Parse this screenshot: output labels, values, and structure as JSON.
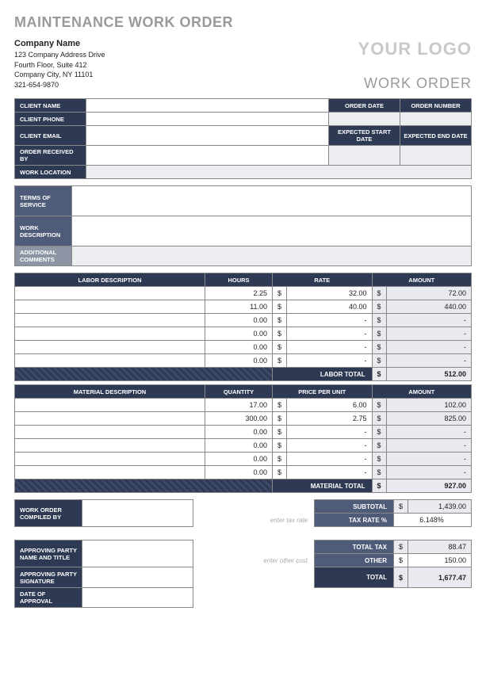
{
  "title": "MAINTENANCE WORK ORDER",
  "company": {
    "name": "Company Name",
    "addr1": "123 Company Address Drive",
    "addr2": "Fourth Floor, Suite 412",
    "city": "Company City, NY 11101",
    "phone": "321-654-9870"
  },
  "logo_text": "YOUR LOGO",
  "work_order_text": "WORK ORDER",
  "client_labels": {
    "name": "CLIENT NAME",
    "phone": "CLIENT PHONE",
    "email": "CLIENT EMAIL",
    "received": "ORDER RECEIVED BY",
    "location": "WORK LOCATION",
    "order_date": "ORDER DATE",
    "order_number": "ORDER NUMBER",
    "exp_start": "EXPECTED START DATE",
    "exp_end": "EXPECTED END DATE"
  },
  "desc_labels": {
    "terms": "TERMS OF SERVICE",
    "work": "WORK DESCRIPTION",
    "comments": "ADDITIONAL COMMENTS"
  },
  "labor": {
    "headers": {
      "desc": "LABOR DESCRIPTION",
      "hours": "HOURS",
      "rate": "RATE",
      "amount": "AMOUNT"
    },
    "rows": [
      {
        "hours": "2.25",
        "rate": "32.00",
        "amount": "72.00"
      },
      {
        "hours": "11.00",
        "rate": "40.00",
        "amount": "440.00"
      },
      {
        "hours": "0.00",
        "rate": "-",
        "amount": "-"
      },
      {
        "hours": "0.00",
        "rate": "-",
        "amount": "-"
      },
      {
        "hours": "0.00",
        "rate": "-",
        "amount": "-"
      },
      {
        "hours": "0.00",
        "rate": "-",
        "amount": "-"
      }
    ],
    "total_label": "LABOR TOTAL",
    "total": "512.00"
  },
  "material": {
    "headers": {
      "desc": "MATERIAL DESCRIPTION",
      "qty": "QUANTITY",
      "ppu": "PRICE PER UNIT",
      "amount": "AMOUNT"
    },
    "rows": [
      {
        "qty": "17.00",
        "ppu": "6.00",
        "amount": "102.00"
      },
      {
        "qty": "300.00",
        "ppu": "2.75",
        "amount": "825.00"
      },
      {
        "qty": "0.00",
        "ppu": "-",
        "amount": "-"
      },
      {
        "qty": "0.00",
        "ppu": "-",
        "amount": "-"
      },
      {
        "qty": "0.00",
        "ppu": "-",
        "amount": "-"
      },
      {
        "qty": "0.00",
        "ppu": "-",
        "amount": "-"
      }
    ],
    "total_label": "MATERIAL TOTAL",
    "total": "927.00"
  },
  "footer": {
    "compiled_by": "WORK ORDER COMPILED BY",
    "approving_name": "APPROVING PARTY NAME AND TITLE",
    "approving_sig": "APPROVING PARTY SIGNATURE",
    "date_approval": "DATE OF APPROVAL",
    "hint_tax": "enter tax rate",
    "hint_other": "enter other cost",
    "subtotal_lbl": "SUBTOTAL",
    "tax_rate_lbl": "TAX RATE %",
    "total_tax_lbl": "TOTAL TAX",
    "other_lbl": "OTHER",
    "total_lbl": "TOTAL",
    "subtotal": "1,439.00",
    "tax_rate": "6.148%",
    "total_tax": "88.47",
    "other": "150.00",
    "total": "1,677.47"
  },
  "currency": "$"
}
